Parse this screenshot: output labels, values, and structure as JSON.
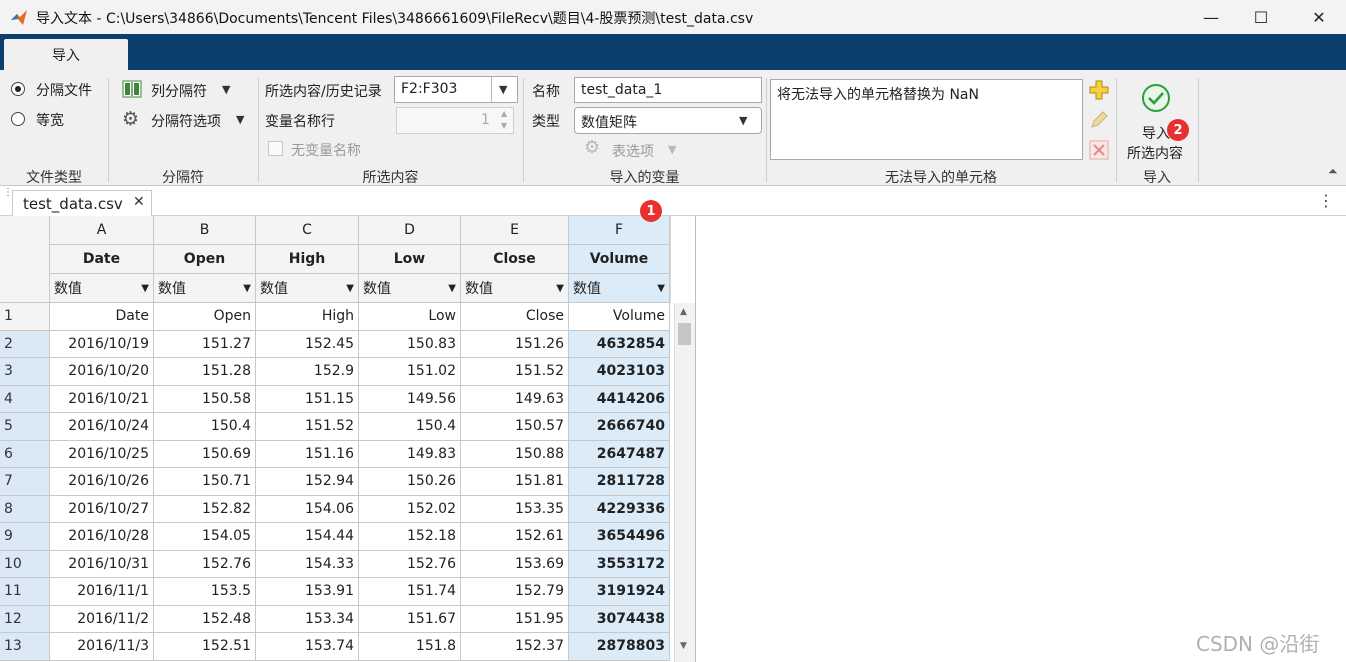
{
  "window": {
    "title": "导入文本 - C:\\Users\\34866\\Documents\\Tencent Files\\3486661609\\FileRecv\\题目\\4-股票预测\\test_data.csv",
    "minimize": "—",
    "maximize": "☐",
    "close": "✕"
  },
  "ribbon_tab": "导入",
  "file_type": {
    "option1": "分隔文件",
    "option2": "等宽",
    "label": "文件类型"
  },
  "delimiter": {
    "column_delimiter": "列分隔符",
    "delimiter_options": "分隔符选项",
    "label": "分隔符"
  },
  "selection": {
    "range_label": "所选内容/历史记录",
    "range_value": "F2:F303",
    "varname_row_label": "变量名称行",
    "varname_row_value": "1",
    "no_varnames": "无变量名称",
    "label": "所选内容"
  },
  "imported_vars": {
    "name_label": "名称",
    "name_value": "test_data_1",
    "type_label": "类型",
    "type_value": "数值矩阵",
    "table_options": "表选项",
    "label": "导入的变量"
  },
  "unimportable": {
    "rule_text": "将无法导入的单元格替换为 NaN",
    "label": "无法导入的单元格"
  },
  "import_btn": {
    "line1": "导入",
    "line2": "所选内容",
    "label": "导入"
  },
  "doc_tab": {
    "name": "test_data.csv",
    "close": "✕"
  },
  "badges": {
    "one": "1",
    "two": "2"
  },
  "grid": {
    "col_letters": [
      "A",
      "B",
      "C",
      "D",
      "E",
      "F"
    ],
    "col_names": [
      "Date",
      "Open",
      "High",
      "Low",
      "Close",
      "Volume"
    ],
    "col_types": [
      "数值",
      "数值",
      "数值",
      "数值",
      "数值",
      "数值"
    ],
    "header_row": {
      "num": "1",
      "cells": [
        "Date",
        "Open",
        "High",
        "Low",
        "Close",
        "Volume"
      ]
    },
    "rows": [
      {
        "num": "2",
        "cells": [
          "2016/10/19",
          "151.27",
          "152.45",
          "150.83",
          "151.26",
          "4632854"
        ]
      },
      {
        "num": "3",
        "cells": [
          "2016/10/20",
          "151.28",
          "152.9",
          "151.02",
          "151.52",
          "4023103"
        ]
      },
      {
        "num": "4",
        "cells": [
          "2016/10/21",
          "150.58",
          "151.15",
          "149.56",
          "149.63",
          "4414206"
        ]
      },
      {
        "num": "5",
        "cells": [
          "2016/10/24",
          "150.4",
          "151.52",
          "150.4",
          "150.57",
          "2666740"
        ]
      },
      {
        "num": "6",
        "cells": [
          "2016/10/25",
          "150.69",
          "151.16",
          "149.83",
          "150.88",
          "2647487"
        ]
      },
      {
        "num": "7",
        "cells": [
          "2016/10/26",
          "150.71",
          "152.94",
          "150.26",
          "151.81",
          "2811728"
        ]
      },
      {
        "num": "8",
        "cells": [
          "2016/10/27",
          "152.82",
          "154.06",
          "152.02",
          "153.35",
          "4229336"
        ]
      },
      {
        "num": "9",
        "cells": [
          "2016/10/28",
          "154.05",
          "154.44",
          "152.18",
          "152.61",
          "3654496"
        ]
      },
      {
        "num": "10",
        "cells": [
          "2016/10/31",
          "152.76",
          "154.33",
          "152.76",
          "153.69",
          "3553172"
        ]
      },
      {
        "num": "11",
        "cells": [
          "2016/11/1",
          "153.5",
          "153.91",
          "151.74",
          "152.79",
          "3191924"
        ]
      },
      {
        "num": "12",
        "cells": [
          "2016/11/2",
          "152.48",
          "153.34",
          "151.67",
          "151.95",
          "3074438"
        ]
      },
      {
        "num": "13",
        "cells": [
          "2016/11/3",
          "152.51",
          "153.74",
          "151.8",
          "152.37",
          "2878803"
        ]
      }
    ]
  },
  "watermark": "CSDN @沿街",
  "colors": {
    "accent": "#0b3f6e",
    "selection": "#dcebf8",
    "badge": "#e8312f"
  }
}
